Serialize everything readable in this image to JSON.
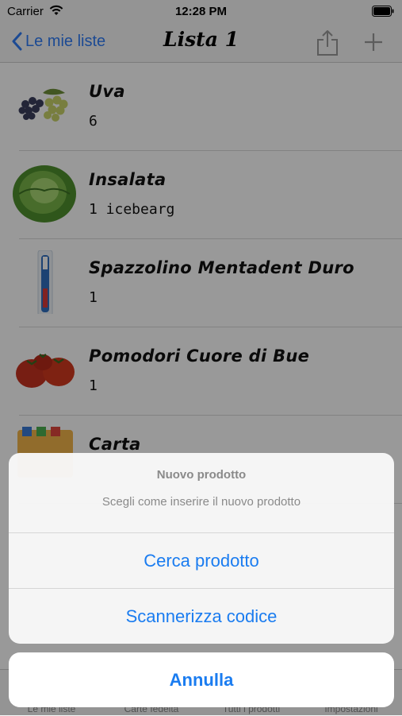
{
  "status_bar": {
    "carrier": "Carrier",
    "time": "12:28 PM",
    "wifi_icon": "wifi-icon",
    "battery_icon": "battery-icon"
  },
  "nav": {
    "back_label": "Le mie liste",
    "title": "Lista 1",
    "share_icon": "share-icon",
    "add_icon": "plus-icon",
    "accent": "#2f7cf6"
  },
  "items": [
    {
      "name": "Uva",
      "qty": "6",
      "image": "grapes-image"
    },
    {
      "name": "Insalata",
      "qty": "1 icebearg",
      "image": "lettuce-image"
    },
    {
      "name": "Spazzolino Mentadent Duro",
      "qty": "1",
      "image": "toothbrush-image"
    },
    {
      "name": "Pomodori Cuore di Bue",
      "qty": "1",
      "image": "tomatoes-image"
    },
    {
      "name": "Carta",
      "qty": "",
      "image": "paper-image"
    }
  ],
  "tabs": [
    "Le mie liste",
    "Carte fedeltà",
    "Tutti i prodotti",
    "Impostazioni"
  ],
  "action_sheet": {
    "title": "Nuovo prodotto",
    "message": "Scegli come inserire il nuovo prodotto",
    "actions": [
      "Cerca prodotto",
      "Scannerizza codice"
    ],
    "cancel": "Annulla",
    "action_color": "#1a7cf0"
  }
}
